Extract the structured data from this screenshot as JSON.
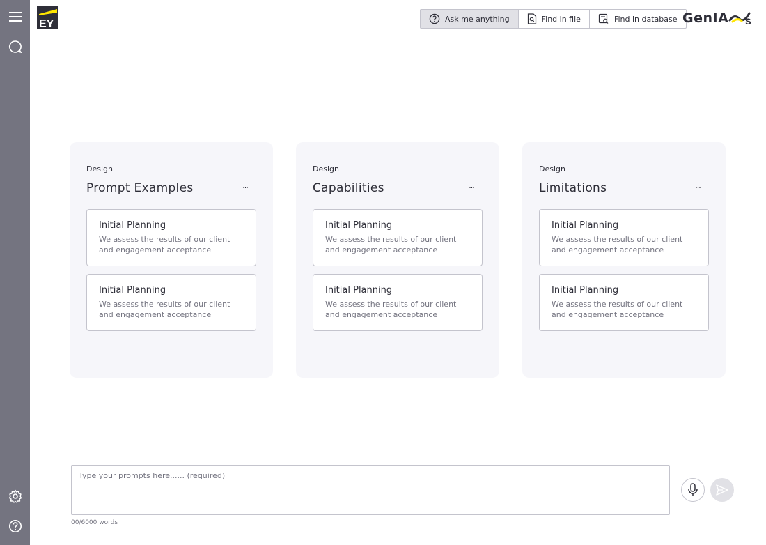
{
  "header": {
    "modes": [
      {
        "label": "Ask me anything",
        "icon": "help-circle-icon",
        "active": true
      },
      {
        "label": "Find in file",
        "icon": "file-search-icon",
        "active": false
      },
      {
        "label": "Find in database",
        "icon": "database-search-icon",
        "active": false
      }
    ],
    "brand": "GenIA"
  },
  "sidebar": {
    "icons": [
      "menu-icon",
      "chat-icon",
      "settings-icon",
      "help-icon"
    ]
  },
  "panels": [
    {
      "eyebrow": "Design",
      "title": "Prompt Examples",
      "more": "···",
      "cards": [
        {
          "title": "Initial Planning",
          "desc": "We assess the results of our client and engagement acceptance"
        },
        {
          "title": "Initial Planning",
          "desc": "We assess the results of our client and engagement acceptance"
        }
      ]
    },
    {
      "eyebrow": "Design",
      "title": "Capabilities",
      "more": "···",
      "cards": [
        {
          "title": "Initial Planning",
          "desc": "We assess the results of our client and engagement acceptance"
        },
        {
          "title": "Initial Planning",
          "desc": "We assess the results of our client and engagement acceptance"
        }
      ]
    },
    {
      "eyebrow": "Design",
      "title": "Limitations",
      "more": "···",
      "cards": [
        {
          "title": "Initial Planning",
          "desc": "We assess the results of our client and engagement acceptance"
        },
        {
          "title": "Initial Planning",
          "desc": "We assess the results of our client and engagement acceptance"
        }
      ]
    }
  ],
  "prompt": {
    "placeholder": "Type your prompts here...... (required)",
    "value": "",
    "word_count": "00/6000 words"
  },
  "colors": {
    "sidebar": "#747480",
    "text": "#2e2e38",
    "muted": "#747480",
    "border": "#c4c4cd",
    "panel_bg": "#f6f6fa",
    "brand_accent": "#ffe600"
  }
}
